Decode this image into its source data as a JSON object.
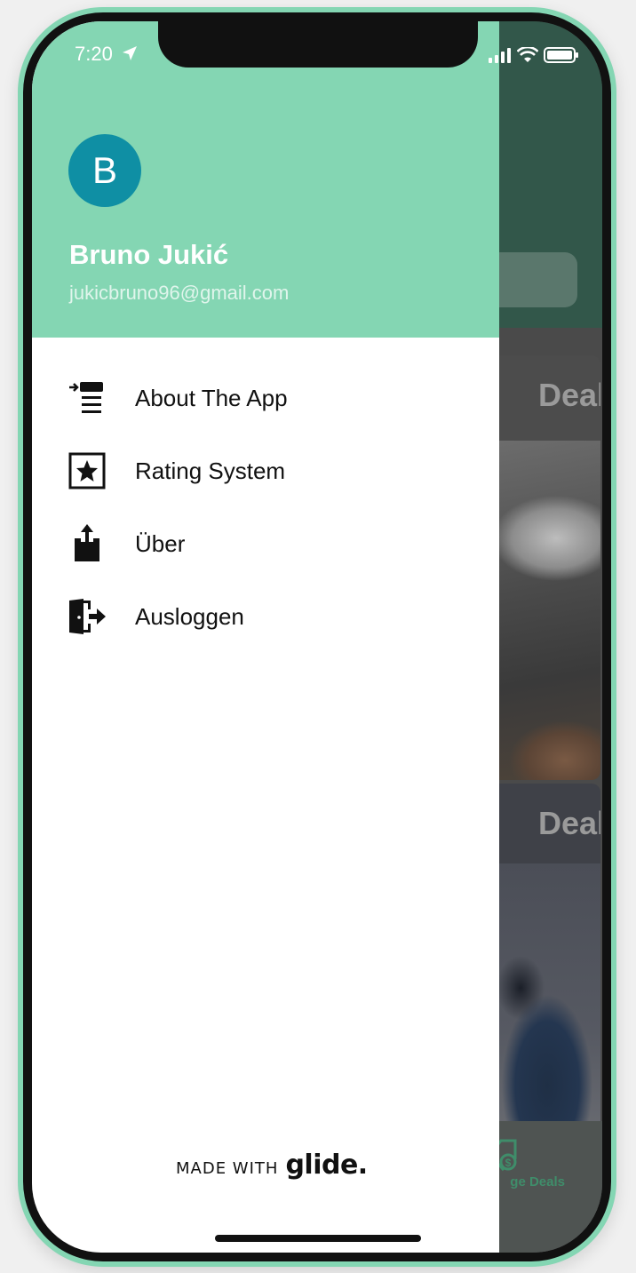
{
  "status_bar": {
    "time": "7:20",
    "icons": [
      "location-arrow-icon",
      "cellular-signal-icon",
      "wifi-icon",
      "battery-icon"
    ]
  },
  "drawer": {
    "avatar_initial": "B",
    "user_name": "Bruno Jukić",
    "user_email": "jukicbruno96@gmail.com",
    "menu": [
      {
        "label": "About The App",
        "icon": "about-app-icon"
      },
      {
        "label": "Rating System",
        "icon": "star-box-icon"
      },
      {
        "label": "Über",
        "icon": "share-upload-icon"
      },
      {
        "label": "Ausloggen",
        "icon": "logout-door-icon"
      }
    ],
    "footer": {
      "prefix": "MADE WITH",
      "brand": "glide."
    }
  },
  "background_app": {
    "cards": [
      {
        "title": "Deal"
      },
      {
        "title": "Deal"
      }
    ],
    "tab_label": "ge Deals"
  },
  "colors": {
    "accent": "#84d6b3",
    "avatar": "#0f8fa4",
    "header_dark": "#32574a"
  }
}
